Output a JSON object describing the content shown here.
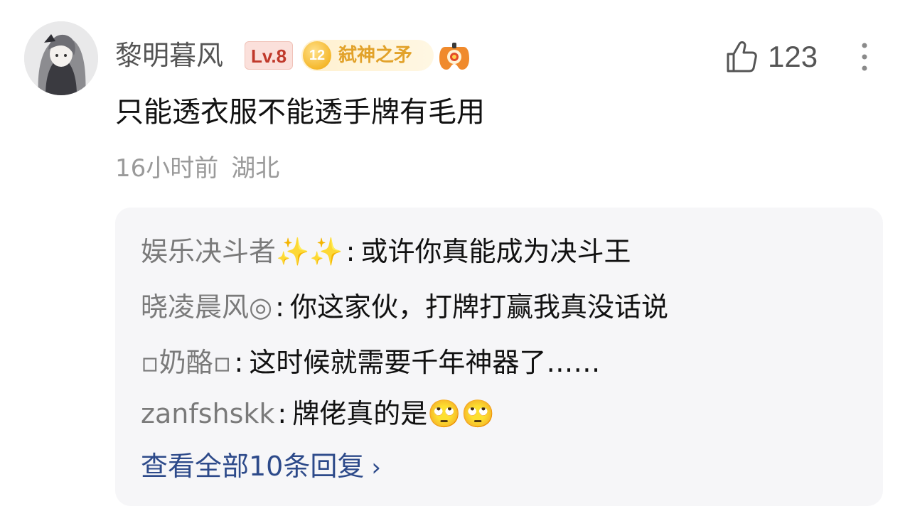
{
  "comment": {
    "username": "黎明暮风",
    "level": "Lv.8",
    "medal": {
      "number": "12",
      "name": "弑神之矛"
    },
    "extra_badge_icon": "gamepad-icon",
    "likes": "123",
    "text": "只能透衣服不能透手牌有毛用",
    "time": "16小时前",
    "location": "湖北"
  },
  "replies": [
    {
      "author": "娱乐决斗者✨✨",
      "text": "或许你真能成为决斗王"
    },
    {
      "author": "晓凌晨风◎",
      "text": "你这家伙，打牌打赢我真没话说"
    },
    {
      "author": "▫奶酪▫",
      "text": "这时候就需要千年神器了……"
    },
    {
      "author": "zanfshskk",
      "text": "牌佬真的是🙄🙄"
    }
  ],
  "view_all_label": "查看全部10条回复",
  "colors": {
    "link": "#2d4a8a",
    "muted": "#9a9a9a",
    "level_bg": "#fbe0db",
    "medal_gold": "#e2a22a",
    "reply_bg": "#f6f6f8"
  }
}
